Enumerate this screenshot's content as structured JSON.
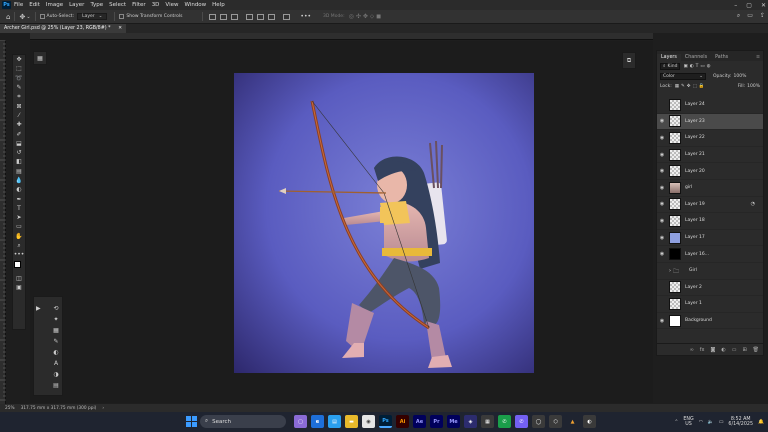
{
  "menubar": {
    "items": [
      "File",
      "Edit",
      "Image",
      "Layer",
      "Type",
      "Select",
      "Filter",
      "3D",
      "View",
      "Window",
      "Help"
    ],
    "logo": "Ps"
  },
  "options_bar": {
    "auto_select_label": "Auto-Select:",
    "auto_select_value": "Layer",
    "show_transform_label": "Show Transform Controls",
    "mode_3d_label": "3D Mode:"
  },
  "document": {
    "tab_title": "Archer Girl.psd @ 25% (Layer 23, RGB/8#) *"
  },
  "layers_panel": {
    "tabs": [
      "Layers",
      "Channels",
      "Paths"
    ],
    "active_tab": "Layers",
    "filter_kind": "Kind",
    "blend_mode": "Color",
    "opacity_label": "Opacity:",
    "opacity_value": "100%",
    "lock_label": "Lock:",
    "fill_label": "Fill:",
    "fill_value": "100%",
    "layers": [
      {
        "name": "Layer 24",
        "visible": false,
        "thumb": "checker",
        "selected": false
      },
      {
        "name": "Layer 23",
        "visible": true,
        "thumb": "checker",
        "selected": true
      },
      {
        "name": "Layer 22",
        "visible": true,
        "thumb": "checker",
        "selected": false
      },
      {
        "name": "Layer 21",
        "visible": true,
        "thumb": "checker",
        "selected": false
      },
      {
        "name": "Layer 20",
        "visible": true,
        "thumb": "checker",
        "selected": false
      },
      {
        "name": "girl",
        "visible": true,
        "thumb": "char",
        "selected": false
      },
      {
        "name": "Layer 19",
        "visible": true,
        "thumb": "checker",
        "selected": false,
        "fx": true
      },
      {
        "name": "Layer 18",
        "visible": true,
        "thumb": "checker",
        "selected": false
      },
      {
        "name": "Layer 17",
        "visible": true,
        "thumb": "blue",
        "selected": false
      },
      {
        "name": "Layer 16...",
        "visible": true,
        "thumb": "black",
        "selected": false
      },
      {
        "name": "Girl",
        "visible": false,
        "thumb": "folder",
        "selected": false
      },
      {
        "name": "Layer 2",
        "visible": false,
        "thumb": "checker",
        "selected": false
      },
      {
        "name": "Layer 1",
        "visible": false,
        "thumb": "checker",
        "selected": false
      },
      {
        "name": "Background",
        "visible": true,
        "thumb": "white",
        "selected": false
      }
    ]
  },
  "status_bar": {
    "zoom": "25%",
    "doc_size": "317.75 mm x 317.75 mm (300 ppi)"
  },
  "taskbar": {
    "search_placeholder": "Search",
    "lang_line1": "ENG",
    "lang_line2": "US",
    "time": "8:52 AM",
    "date": "6/14/2025",
    "apps": [
      "Ai",
      "Ae",
      "Pr",
      "Me",
      "Ps"
    ]
  },
  "colors": {
    "canvas_bg_center": "#6f74c8",
    "canvas_bg_edge": "#2f2a6a",
    "accent": "#31a8ff"
  }
}
